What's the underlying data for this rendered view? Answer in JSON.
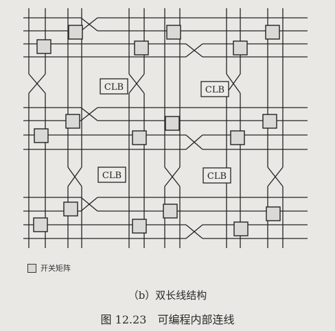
{
  "clb_label": "CLB",
  "legend": {
    "label": "开关矩阵"
  },
  "subcaption": "（b）双长线结构",
  "caption": "图 12.23　可编程内部连线",
  "colors": {
    "line": "#222222",
    "background": "#e9e8e4",
    "box_fill": "#d9d9d6"
  }
}
